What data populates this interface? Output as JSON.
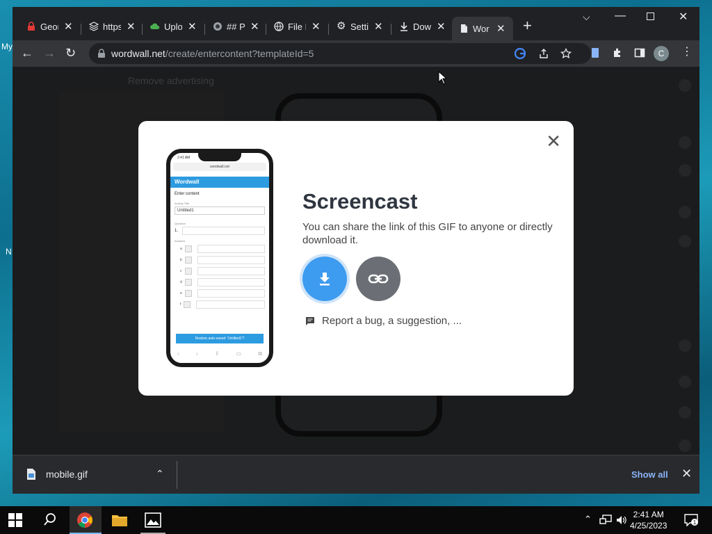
{
  "desktop": {
    "left_texts": [
      "My",
      "N"
    ]
  },
  "tabs": [
    {
      "label": "Geor",
      "icon": "lock-icon"
    },
    {
      "label": "https",
      "icon": "stack-icon"
    },
    {
      "label": "Uplo",
      "icon": "cloud-icon"
    },
    {
      "label": "## P",
      "icon": "globe-icon"
    },
    {
      "label": "File I",
      "icon": "globe-icon"
    },
    {
      "label": "Settin",
      "icon": "gear-icon"
    },
    {
      "label": "Dow",
      "icon": "download-icon"
    },
    {
      "label": "Wor",
      "icon": "document-icon",
      "active": true
    }
  ],
  "address_bar": {
    "host": "wordwall.net",
    "path": "/create/entercontent?templateId=5"
  },
  "profile": {
    "initial": "C"
  },
  "page": {
    "remove_ad": "Remove advertising"
  },
  "modal": {
    "title": "Screencast",
    "description": "You can share the link of this GIF to anyone or directly download it.",
    "report_link": "Report a bug, a suggestion, ...",
    "preview": {
      "status_time": "2:41 AM",
      "url": "wordwall.net",
      "brand": "Wordwall",
      "heading": "Enter content",
      "activity_label": "Activity Title",
      "activity_value": "Untitled1",
      "question_label": "Question",
      "question_number": "1.",
      "answers_label": "Answers",
      "answer_letters": [
        "a",
        "b",
        "c",
        "d",
        "e",
        "f"
      ],
      "banner": "Restore auto-saved: 'Untitled1'?"
    }
  },
  "downloads": {
    "file": "mobile.gif",
    "show_all": "Show all"
  },
  "taskbar": {
    "time": "2:41 AM",
    "date": "4/25/2023"
  },
  "colors": {
    "accent_blue": "#3d9bf0",
    "link_gray": "#6b6f75",
    "chrome_dark": "#202124"
  }
}
